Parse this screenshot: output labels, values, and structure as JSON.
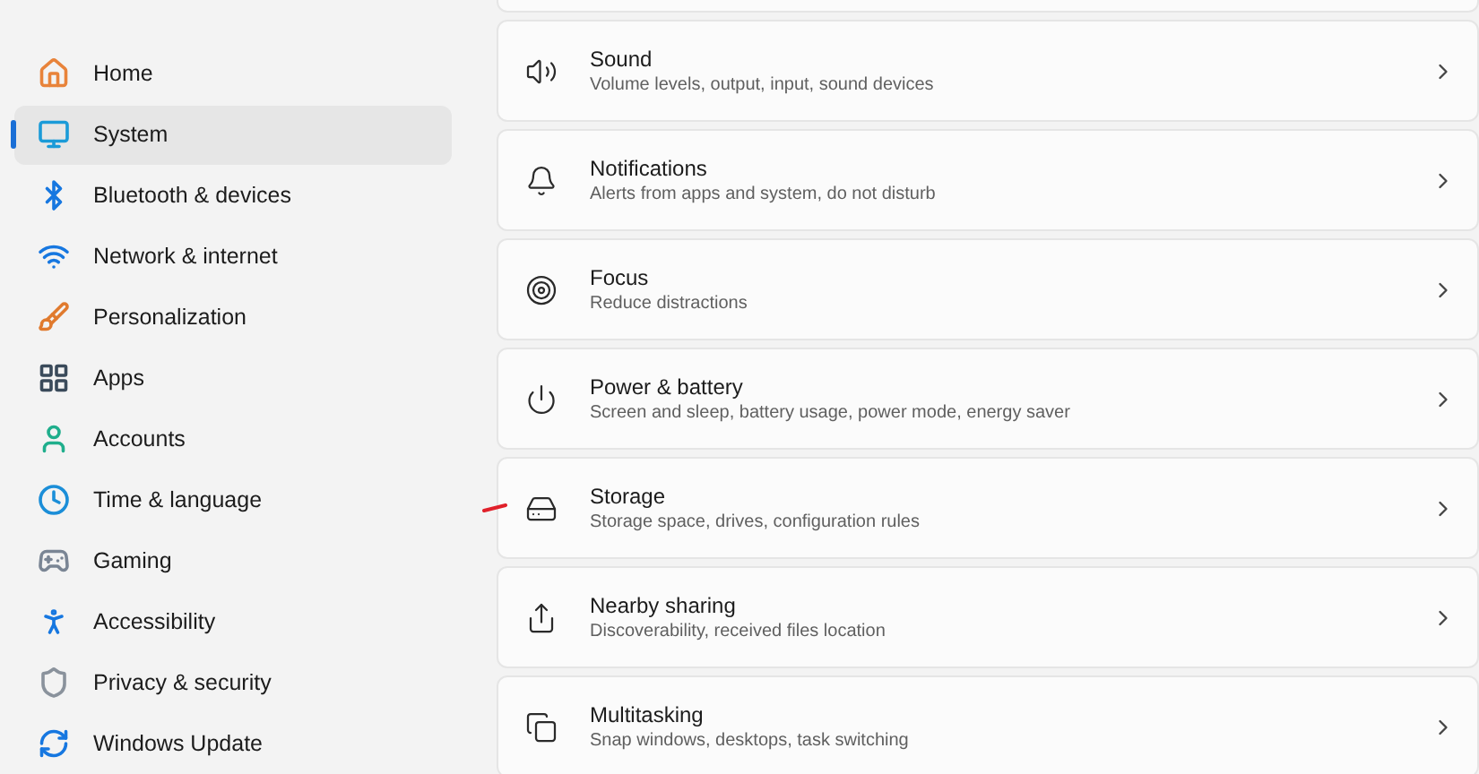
{
  "sidebar": {
    "items": [
      {
        "label": "Home",
        "selected": false
      },
      {
        "label": "System",
        "selected": true
      },
      {
        "label": "Bluetooth & devices",
        "selected": false
      },
      {
        "label": "Network & internet",
        "selected": false
      },
      {
        "label": "Personalization",
        "selected": false
      },
      {
        "label": "Apps",
        "selected": false
      },
      {
        "label": "Accounts",
        "selected": false
      },
      {
        "label": "Time & language",
        "selected": false
      },
      {
        "label": "Gaming",
        "selected": false
      },
      {
        "label": "Accessibility",
        "selected": false
      },
      {
        "label": "Privacy & security",
        "selected": false
      },
      {
        "label": "Windows Update",
        "selected": false
      }
    ]
  },
  "settings": [
    {
      "title": "Sound",
      "description": "Volume levels, output, input, sound devices"
    },
    {
      "title": "Notifications",
      "description": "Alerts from apps and system, do not disturb"
    },
    {
      "title": "Focus",
      "description": "Reduce distractions"
    },
    {
      "title": "Power & battery",
      "description": "Screen and sleep, battery usage, power mode, energy saver"
    },
    {
      "title": "Storage",
      "description": "Storage space, drives, configuration rules",
      "annotated": true
    },
    {
      "title": "Nearby sharing",
      "description": "Discoverability, received files location"
    },
    {
      "title": "Multitasking",
      "description": "Snap windows, desktops, task switching"
    }
  ]
}
